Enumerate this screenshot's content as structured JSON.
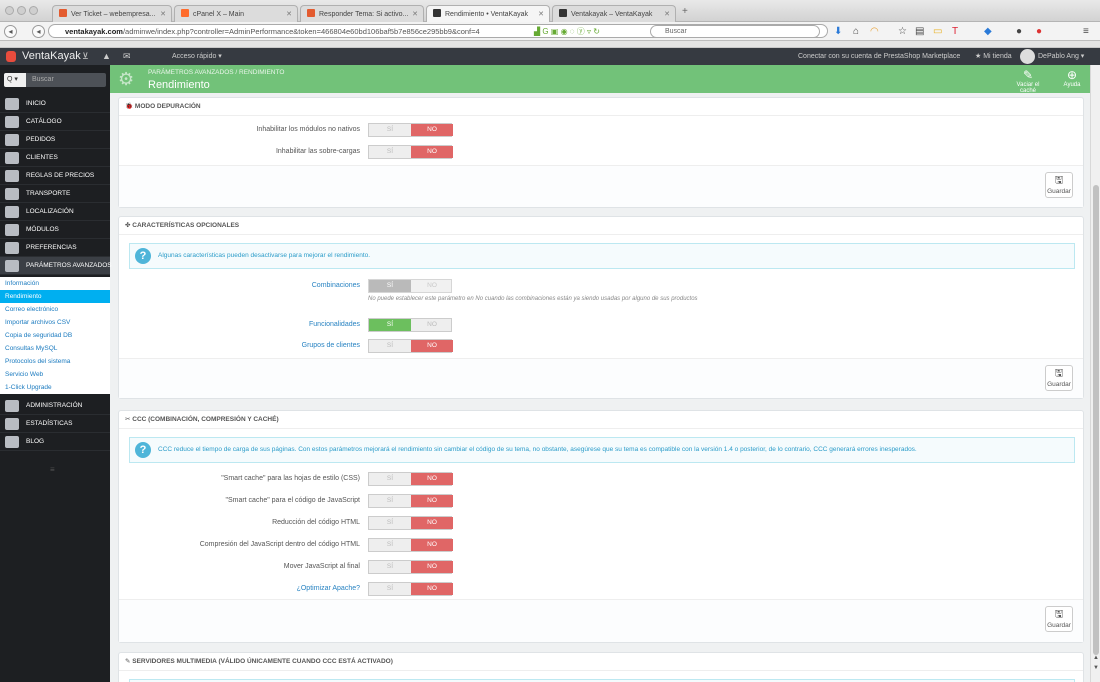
{
  "browser": {
    "tabs": [
      {
        "label": "Ver Ticket – webempresa...",
        "fav": "#e35b2f"
      },
      {
        "label": "cPanel X – Main",
        "fav": "#ff6c2c"
      },
      {
        "label": "Responder Tema: Si activo...",
        "fav": "#e35b2f"
      },
      {
        "label": "Rendimiento • VentaKayak",
        "fav": "#333333"
      },
      {
        "label": "Ventakayak – VentaKayak",
        "fav": "#333333"
      }
    ],
    "url_domain": "ventakayak.com",
    "url_path": "/adminwe/index.php?controller=AdminPerformance&token=466804e60bd106baf5b7e856ce295bb9&conf=4",
    "search_placeholder": "Buscar"
  },
  "topbar": {
    "brand": "VentaKayak",
    "quick_access": "Acceso rápido ▾",
    "connect": "Conectar con su cuenta de PrestaShop Marketplace",
    "my_store": "★ Mi tienda",
    "user": "DePablo Ang ▾"
  },
  "sidebar": {
    "search_label": "Q ▾",
    "search_placeholder": "Buscar",
    "menu": [
      {
        "label": "Inicio"
      },
      {
        "label": "Catálogo"
      },
      {
        "label": "Pedidos"
      },
      {
        "label": "Clientes"
      },
      {
        "label": "Reglas de precios"
      },
      {
        "label": "Transporte"
      },
      {
        "label": "Localización"
      },
      {
        "label": "Módulos"
      },
      {
        "label": "Preferencias"
      },
      {
        "label": "Parámetros avanzados"
      }
    ],
    "submenu": [
      {
        "label": "Información"
      },
      {
        "label": "Rendimiento"
      },
      {
        "label": "Correo electrónico"
      },
      {
        "label": "Importar archivos CSV"
      },
      {
        "label": "Copia de seguridad DB"
      },
      {
        "label": "Consultas MySQL"
      },
      {
        "label": "Protocolos del sistema"
      },
      {
        "label": "Servicio Web"
      },
      {
        "label": "1-Click Upgrade"
      }
    ],
    "menu2": [
      {
        "label": "Administración"
      },
      {
        "label": "Estadísticas"
      },
      {
        "label": "Blog"
      }
    ]
  },
  "header": {
    "breadcrumb": "Parámetros avanzados  /  Rendimiento",
    "title": "Rendimiento",
    "clear_cache": "Vaciar el caché",
    "help": "Ayuda"
  },
  "save_label": "Guardar",
  "yes": "SÍ",
  "no": "NO",
  "debug": {
    "title": "🐞 Modo depuración",
    "rows": [
      {
        "label": "Inhabilitar los módulos no nativos"
      },
      {
        "label": "Inhabilitar las sobre-cargas"
      }
    ]
  },
  "optional": {
    "title": "✤ Características opcionales",
    "alert": "Algunas características pueden desactivarse para mejorar el rendimiento.",
    "rows": [
      {
        "label": "Combinaciones"
      },
      {
        "label": "Funcionalidades"
      },
      {
        "label": "Grupos de clientes"
      }
    ],
    "note": "No puede establecer este parámetro en No cuando las combinaciones están ya siendo usadas por alguno de sus productos"
  },
  "ccc": {
    "title": "✂ CCC (Combinación, compresión y caché)",
    "alert": "CCC reduce el tiempo de carga de sus páginas. Con estos parámetros mejorará el rendimiento sin cambiar el código de su tema, no obstante, asegúrese que su tema es compatible con la versión 1.4 o posterior, de lo contrario, CCC generará errores inesperados.",
    "rows": [
      {
        "label": "\"Smart cache\" para las hojas de estilo (CSS)"
      },
      {
        "label": "\"Smart cache\" para el código de JavaScript"
      },
      {
        "label": "Reducción del código HTML"
      },
      {
        "label": "Compresión del JavaScript dentro del código HTML"
      },
      {
        "label": "Mover JavaScript al final"
      },
      {
        "label": "¿Optimizar Apache?"
      }
    ]
  },
  "media": {
    "title": "✎ Servidores multimedia (válido únicamente cuando CCC está activado)"
  }
}
